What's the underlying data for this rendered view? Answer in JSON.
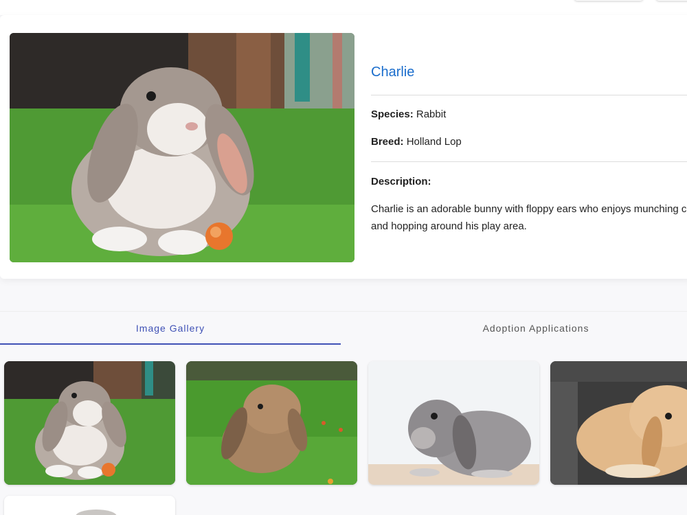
{
  "pet": {
    "name": "Charlie",
    "species_label": "Species:",
    "species": "Rabbit",
    "breed_label": "Breed:",
    "breed": "Holland Lop",
    "description_label": "Description:",
    "description": "Charlie is an adorable bunny with floppy ears who enjoys munching carrots and hopping around his play area."
  },
  "tabs": [
    {
      "label": "Image Gallery",
      "active": true
    },
    {
      "label": "Adoption Applications",
      "active": false
    }
  ],
  "colors": {
    "accent": "#3f51b5",
    "name": "#1a6dcc"
  }
}
